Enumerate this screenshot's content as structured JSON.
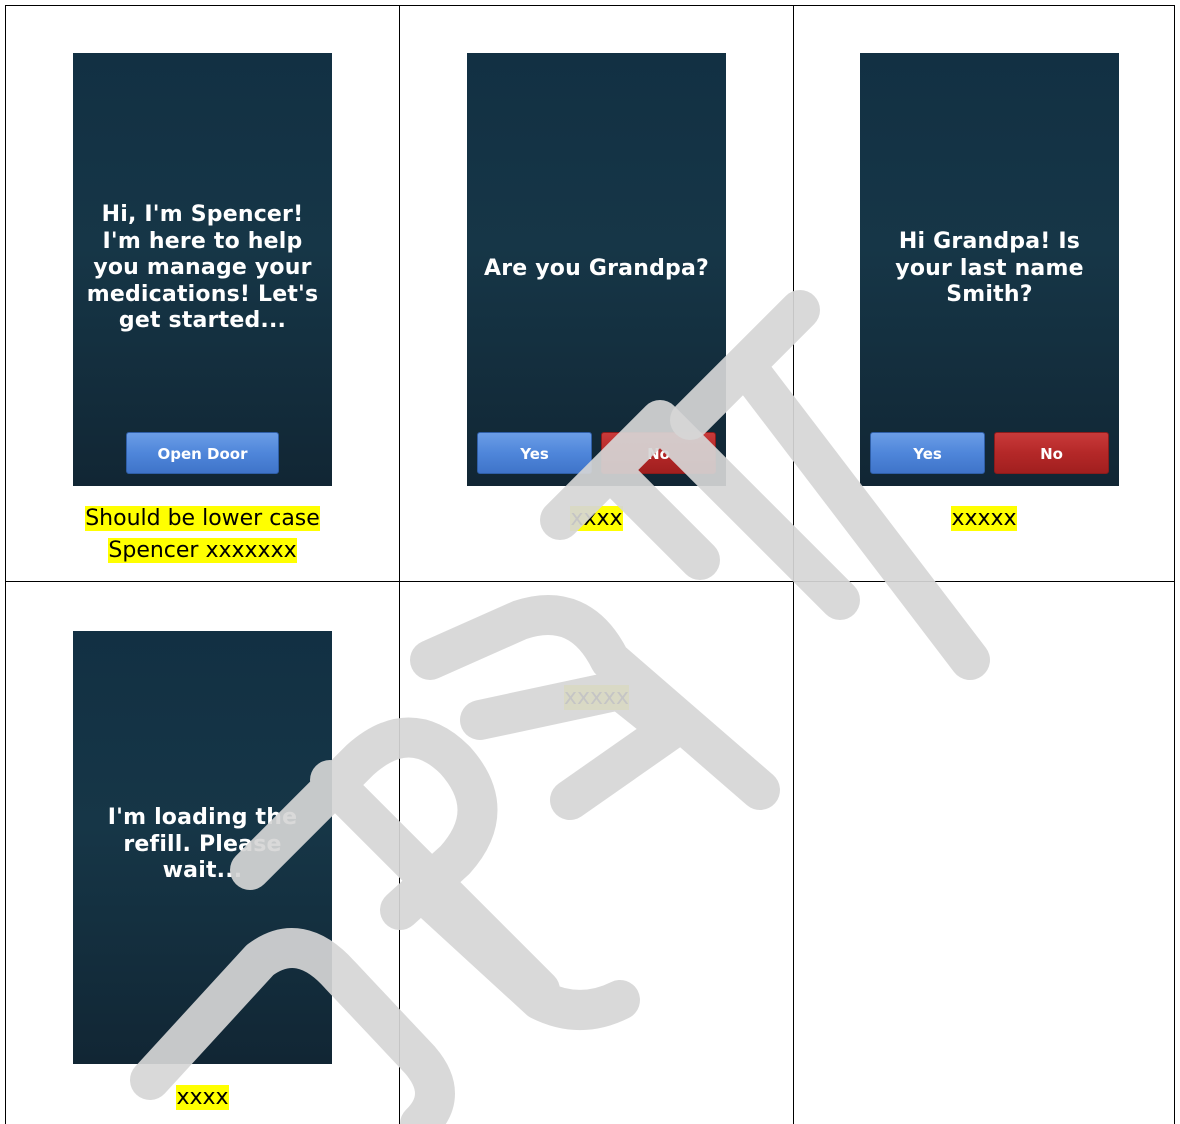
{
  "watermark": {
    "text": "DRAFT"
  },
  "screens": [
    {
      "message": "Hi, I'm Spencer!\nI'm here to help\nyou manage your\nmedications! Let's\nget started...",
      "buttons": [
        "Open Door"
      ],
      "caption_lines": [
        "Should be lower case",
        "Spencer xxxxxxx"
      ]
    },
    {
      "message": "Are you Grandpa?",
      "buttons": [
        "Yes",
        "No"
      ],
      "caption_lines": [
        "xxxx"
      ]
    },
    {
      "message": "Hi Grandpa! Is\nyour last name\nSmith?",
      "buttons": [
        "Yes",
        "No"
      ],
      "caption_lines": [
        "xxxxx"
      ]
    },
    {
      "message": "I'm loading the\nrefill.  Please\nwait...",
      "buttons": [],
      "caption_lines": [
        "xxxx"
      ]
    },
    {
      "message": "",
      "buttons": [],
      "caption_lines": [
        "xxxxx"
      ]
    }
  ],
  "colors": {
    "screen_background": "#163647",
    "highlight": "#ffff00",
    "yes_button": "#4f86da",
    "no_button": "#b42828",
    "watermark": "#d4d4d4"
  }
}
